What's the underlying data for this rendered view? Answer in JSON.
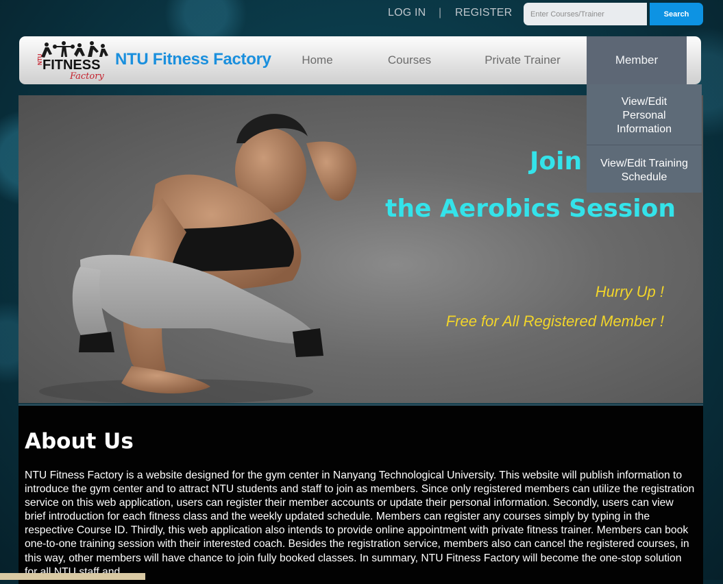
{
  "topbar": {
    "login_label": "LOG IN",
    "separator": "|",
    "register_label": "REGISTER",
    "search_placeholder": "Enter Courses/Trainer",
    "search_button_label": "Search"
  },
  "navbar": {
    "brand": "NTU Fitness Factory",
    "logo_text": "FITNESS",
    "logo_subtext": "Factory",
    "logo_side_text": "NTU",
    "items": [
      {
        "label": "Home"
      },
      {
        "label": "Courses"
      },
      {
        "label": "Private Trainer"
      },
      {
        "label": "Member",
        "active": true
      }
    ],
    "member_dropdown": [
      {
        "label": "View/Edit Personal Information"
      },
      {
        "label": "View/Edit Training Schedule"
      }
    ]
  },
  "hero": {
    "line1": "Join",
    "line2": "the Aerobics Session",
    "sub1": "Hurry Up !",
    "sub2": "Free for All Registered Member !"
  },
  "about": {
    "title": "About Us",
    "body": "NTU Fitness Factory is a website designed for the gym center in Nanyang Technological University. This website will publish information to introduce the gym center and to attract NTU students and staff to join as members. Since only registered members can utilize the registration service on this web application, users can register their member accounts or update their personal information. Secondly, users can view brief introduction for each fitness class and the weekly updated schedule. Members can register any courses simply by typing in the respective Course ID. Thirdly, this web application also intends to provide online appointment with private fitness trainer. Members can book one-to-one training session with their interested coach. Besides the registration service, members also can cancel the registered courses, in this way, other members will have chance to join fully booked classes. In summary, NTU Fitness Factory will become the one-stop solution for all NTU staff and"
  },
  "colors": {
    "brand_blue": "#1a8fdd",
    "search_blue": "#0d93e3",
    "hero_cyan": "#34e3ea",
    "hero_yellow": "#f2d52a",
    "member_active_bg": "#5d6775",
    "dropdown_bg": "#5e6b78"
  }
}
